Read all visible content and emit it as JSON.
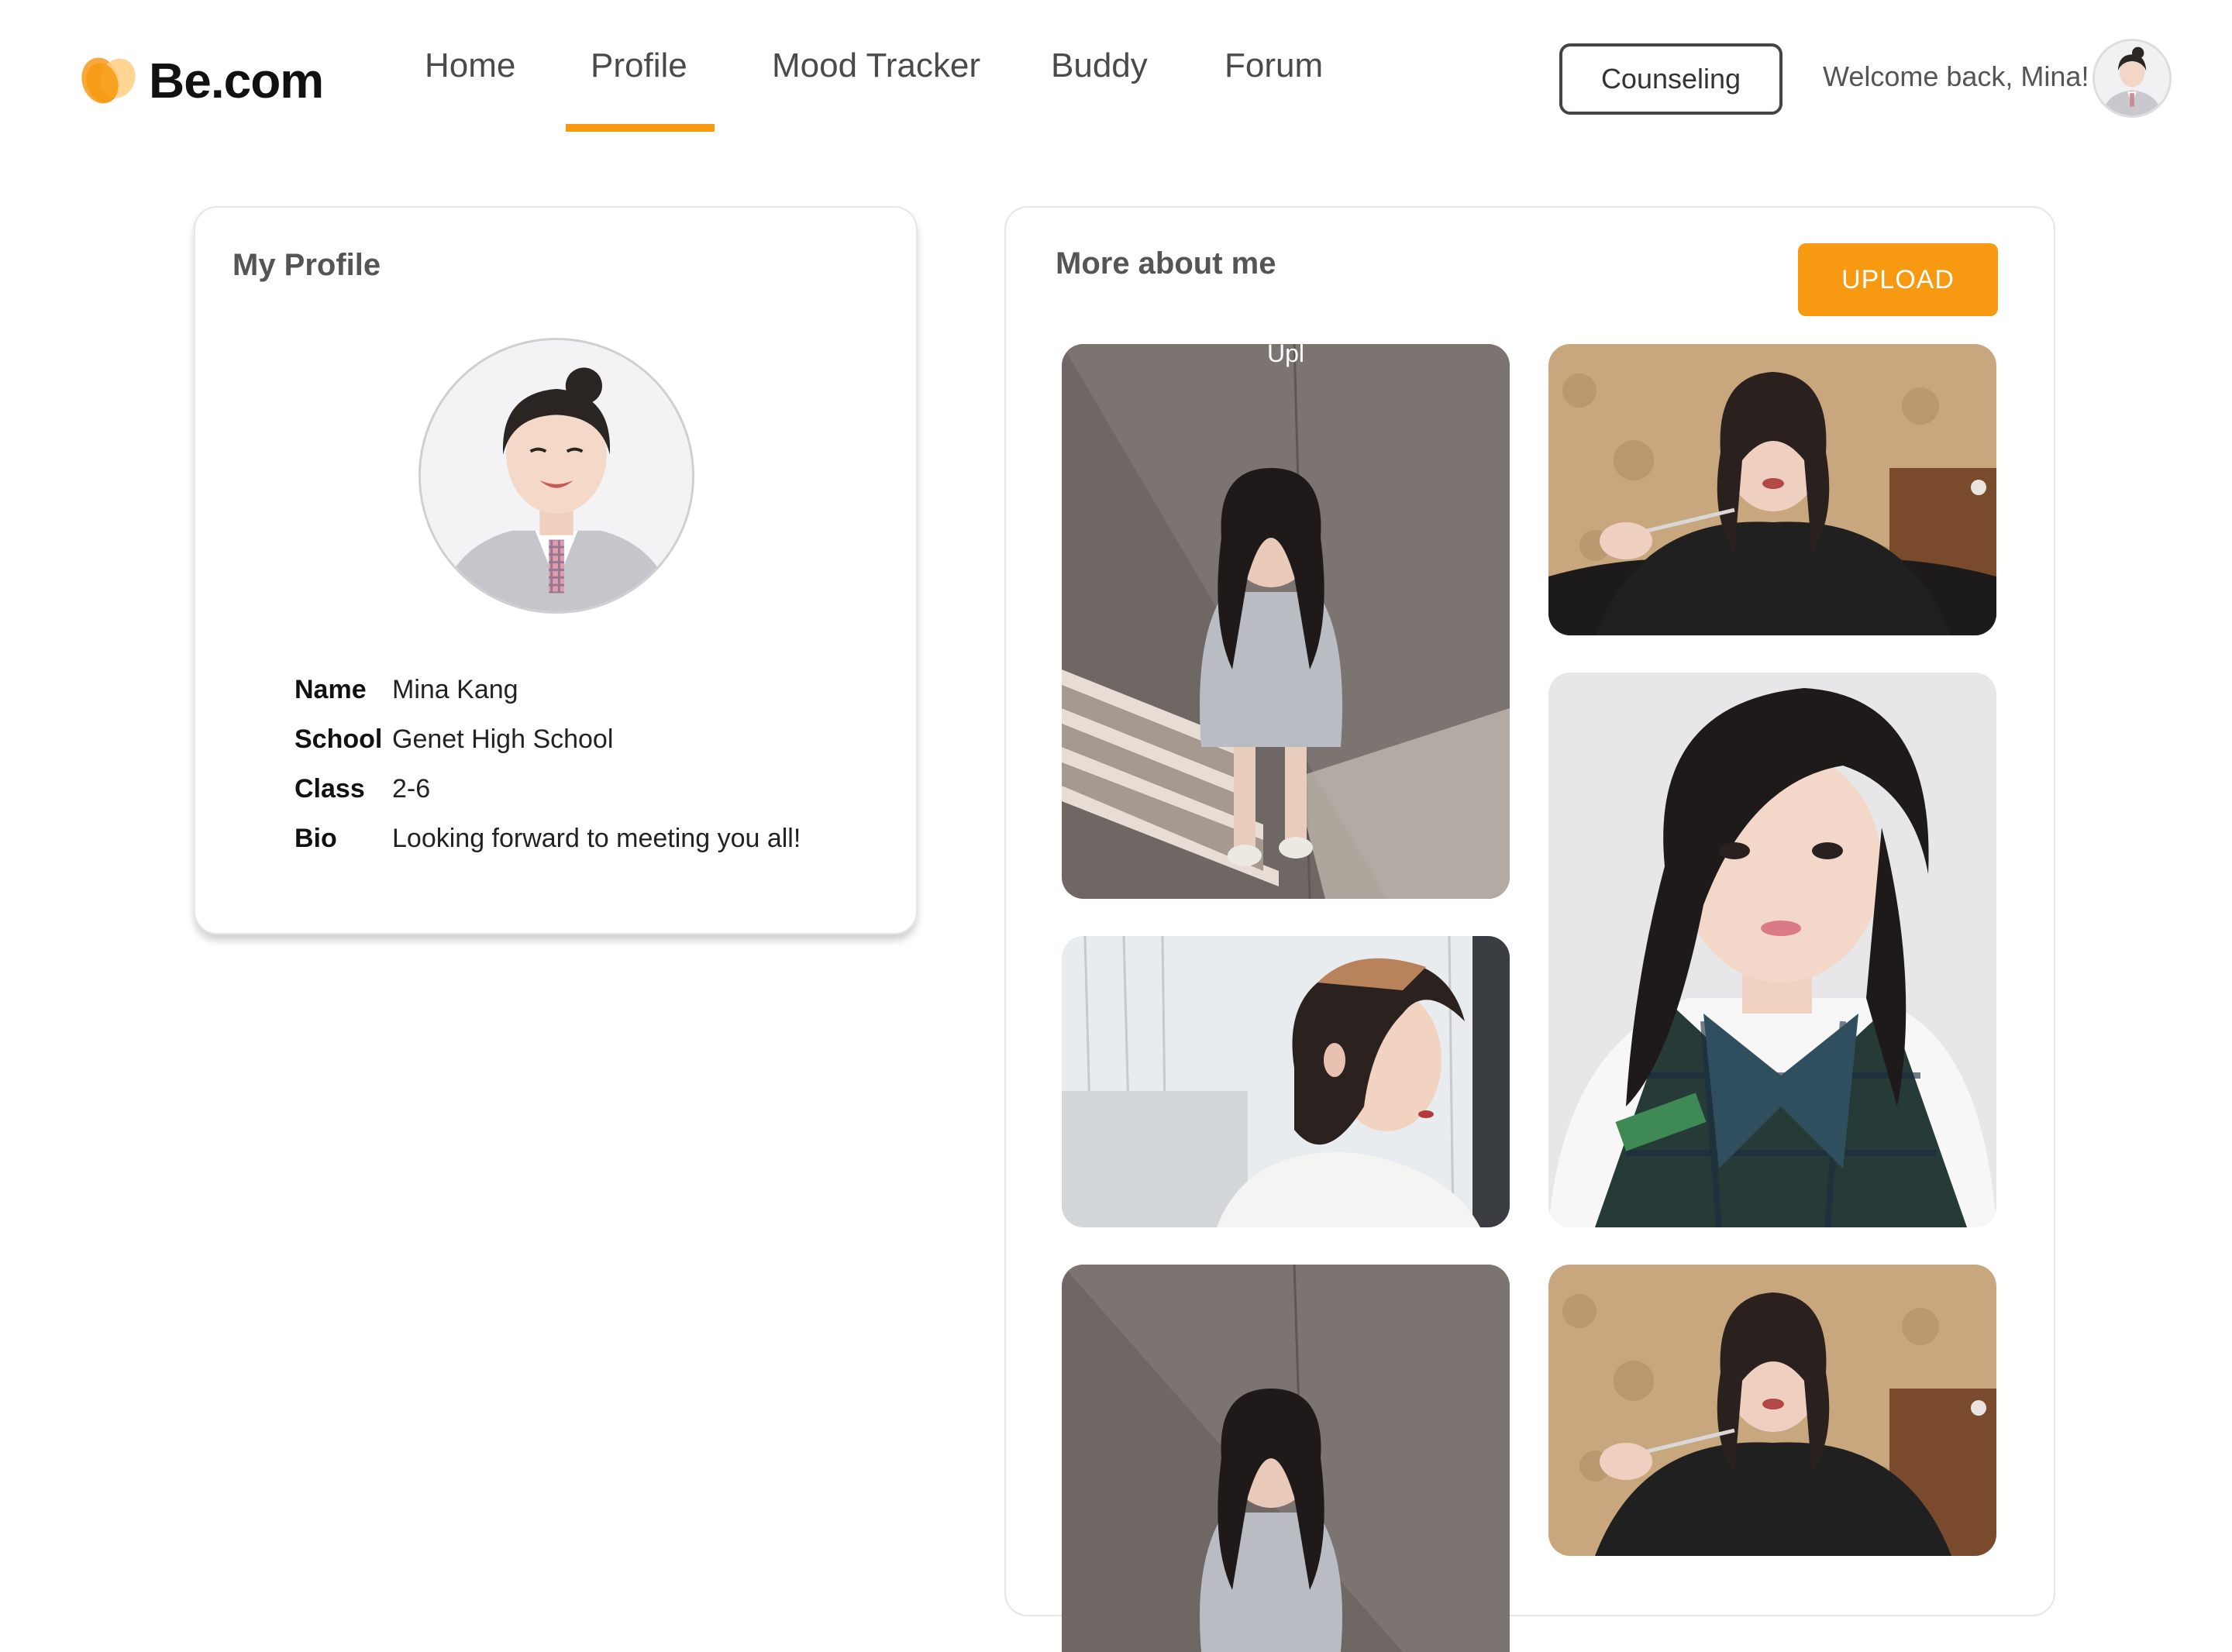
{
  "header": {
    "logo_text": "Be.com",
    "nav": [
      {
        "label": "Home"
      },
      {
        "label": "Profile",
        "active": true
      },
      {
        "label": "Mood Tracker"
      },
      {
        "label": "Buddy"
      },
      {
        "label": "Forum"
      }
    ],
    "counseling_label": "Counseling",
    "welcome_text": "Welcome back, Mina!"
  },
  "profile": {
    "title": "My Profile",
    "fields": [
      {
        "label": "Name",
        "value": "Mina Kang"
      },
      {
        "label": "School",
        "value": "Genet High School"
      },
      {
        "label": "Class",
        "value": "2-6"
      },
      {
        "label": "Bio",
        "value": "Looking forward to meeting you all!"
      }
    ]
  },
  "gallery": {
    "title": "More about me",
    "upload_label": "UPLOAD",
    "first_photo_caption": "Upl",
    "photos": [
      {
        "name": "photo-stairs"
      },
      {
        "name": "photo-eating"
      },
      {
        "name": "photo-uniform-selfie"
      },
      {
        "name": "photo-side-profile"
      },
      {
        "name": "photo-stairs"
      },
      {
        "name": "photo-eating"
      }
    ]
  },
  "colors": {
    "accent": "#F79A12",
    "text_dark": "#222222",
    "text_muted": "#555555"
  }
}
